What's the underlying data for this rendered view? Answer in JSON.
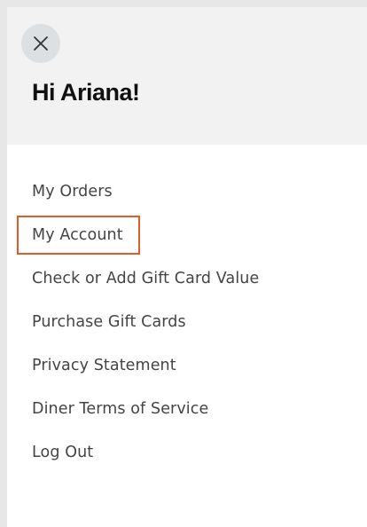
{
  "header": {
    "close_icon": "close-icon",
    "greeting": "Hi Ariana!"
  },
  "menu": {
    "items": [
      {
        "label": "My Orders"
      },
      {
        "label": "My Account",
        "focused": true
      },
      {
        "label": "Check or Add Gift Card Value"
      },
      {
        "label": "Purchase Gift Cards"
      },
      {
        "label": "Privacy Statement"
      },
      {
        "label": "Diner Terms of Service"
      },
      {
        "label": "Log Out"
      }
    ]
  },
  "colors": {
    "page_background": "#e7e7e7",
    "panel_background": "#ffffff",
    "header_background": "#f2f2f2",
    "close_button_background": "#dde0e3",
    "focus_outline": "#e05d27",
    "menu_text": "#444444",
    "greeting_text": "#111111"
  }
}
